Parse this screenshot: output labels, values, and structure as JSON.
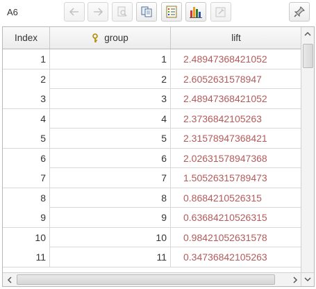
{
  "cell_ref": "A6",
  "colors": {
    "lift_text": "#b35a5a",
    "header_bg": "#ececec",
    "border": "#b8b8b8"
  },
  "toolbar": {
    "buttons": [
      {
        "icon": "back-arrow-icon",
        "enabled": false
      },
      {
        "icon": "forward-arrow-icon",
        "enabled": false
      },
      {
        "icon": "zoom-icon",
        "enabled": false
      },
      {
        "icon": "copy-icon",
        "enabled": true
      },
      {
        "icon": "list-icon",
        "enabled": true
      },
      {
        "icon": "bar-chart-icon",
        "enabled": true
      },
      {
        "icon": "settings-icon",
        "enabled": false
      },
      {
        "icon": "pin-icon",
        "enabled": true
      }
    ]
  },
  "table": {
    "columns": [
      "Index",
      "group",
      "lift"
    ],
    "rows": [
      [
        "1",
        "1",
        "2.48947368421052"
      ],
      [
        "2",
        "2",
        "2.6052631578947"
      ],
      [
        "3",
        "3",
        "2.48947368421052"
      ],
      [
        "4",
        "4",
        "2.3736842105263"
      ],
      [
        "5",
        "5",
        "2.31578947368421"
      ],
      [
        "6",
        "6",
        "2.02631578947368"
      ],
      [
        "7",
        "7",
        "1.50526315789473"
      ],
      [
        "8",
        "8",
        "0.8684210526315"
      ],
      [
        "9",
        "9",
        "0.63684210526315"
      ],
      [
        "10",
        "10",
        "0.98421052631578"
      ],
      [
        "11",
        "11",
        "0.34736842105263"
      ]
    ]
  }
}
